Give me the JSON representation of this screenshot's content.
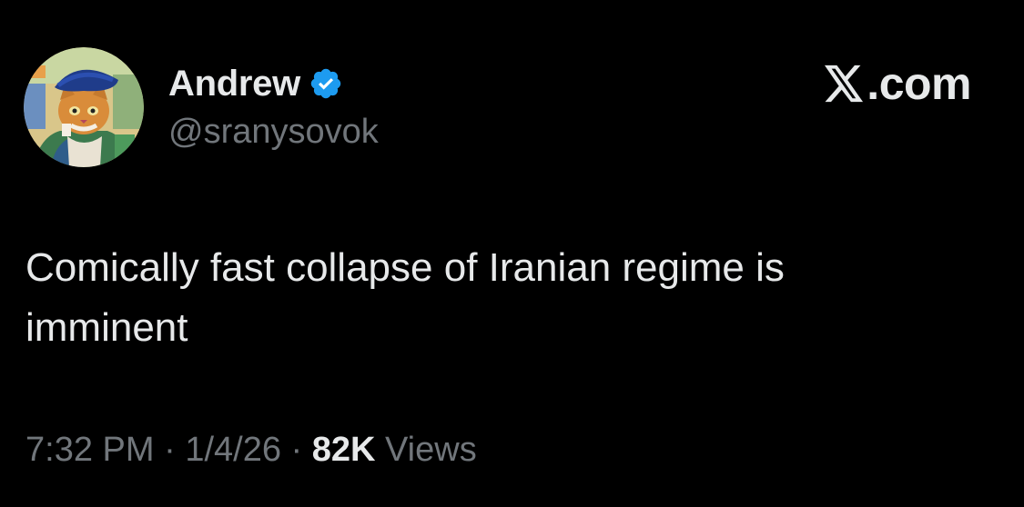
{
  "tweet": {
    "author": {
      "display_name": "Andrew",
      "handle": "@sranysovok",
      "verified": true,
      "verified_color": "#1d9bf0",
      "avatar_icon": "cat-portrait-avatar"
    },
    "brand": {
      "icon": "x-logo-icon",
      "label": ".com"
    },
    "text": "Comically fast collapse of Iranian regime is\nimminent",
    "meta": {
      "time": "7:32 PM",
      "separator": " · ",
      "date": "1/4/26",
      "views_count": "82K",
      "views_label": " Views"
    }
  },
  "colors": {
    "background": "#000000",
    "primary_text": "#e7e9ea",
    "secondary_text": "#71767b",
    "accent": "#1d9bf0"
  }
}
